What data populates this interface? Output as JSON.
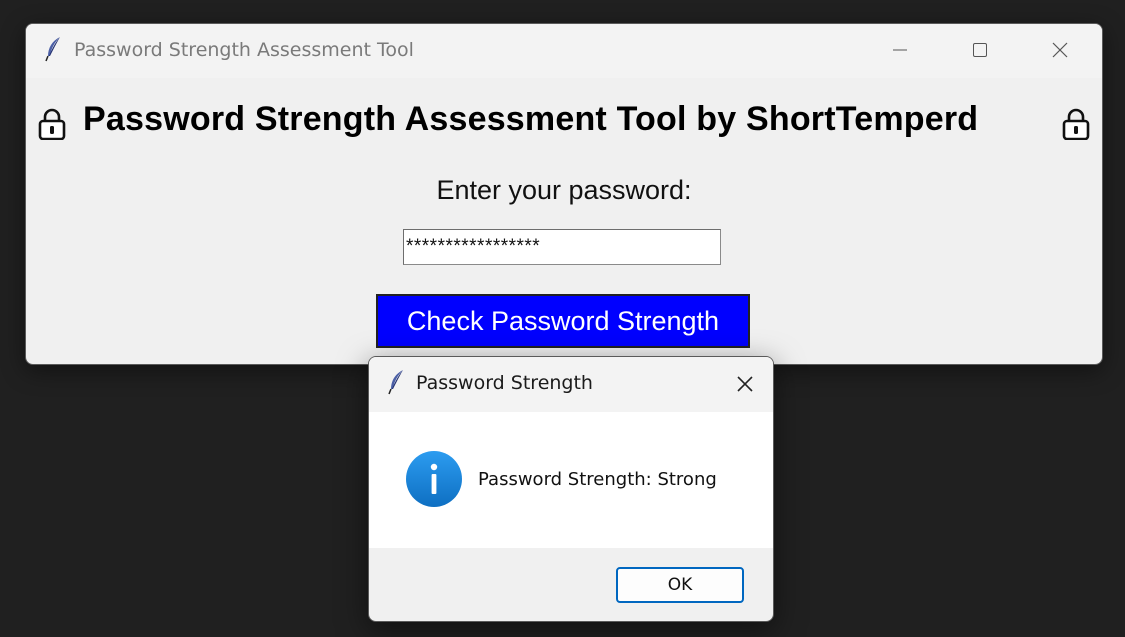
{
  "main_window": {
    "title": "Password Strength Assessment Tool",
    "icon": "feather-icon",
    "caption_buttons": [
      "minimize",
      "maximize",
      "close"
    ],
    "heading": "Password Strength Assessment Tool by ShortTemperd",
    "heading_icon": "lock-icon",
    "prompt_label": "Enter your password:",
    "password_value": "*****************",
    "check_button_label": "Check Password Strength",
    "colors": {
      "check_button_bg": "#0000ff",
      "check_button_fg": "#ffffff"
    }
  },
  "dialog": {
    "title": "Password Strength",
    "icon": "feather-icon",
    "message_icon": "info-icon",
    "message": "Password Strength: Strong",
    "ok_label": "OK",
    "colors": {
      "info_icon": "#1a86d9",
      "ok_border": "#0067c0"
    }
  }
}
